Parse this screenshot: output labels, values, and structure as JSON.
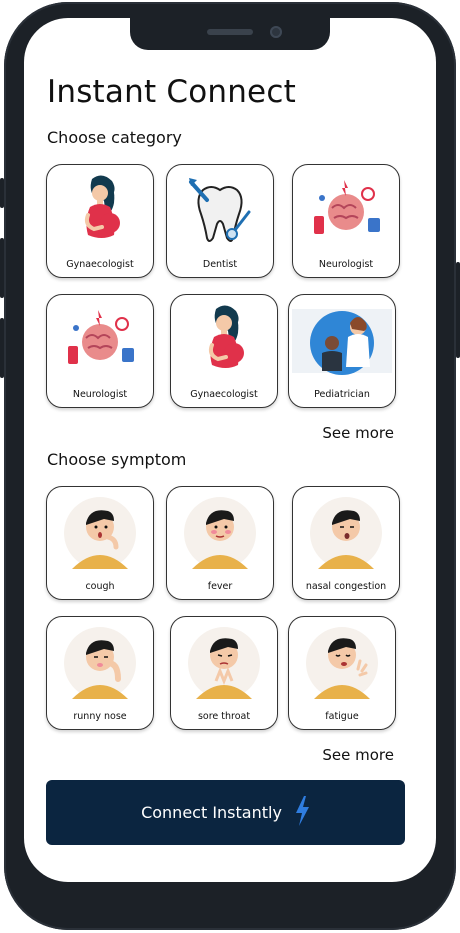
{
  "page": {
    "title": "Instant Connect",
    "category_heading": "Choose category",
    "symptom_heading": "Choose symptom",
    "see_more_categories": "See more",
    "see_more_symptoms": "See more",
    "cta_label": "Connect Instantly"
  },
  "categories": [
    {
      "label": "Gynaecologist",
      "icon": "pregnant-woman-icon"
    },
    {
      "label": "Dentist",
      "icon": "tooth-icon"
    },
    {
      "label": "Neurologist",
      "icon": "brain-icon"
    },
    {
      "label": "Neurologist",
      "icon": "brain-icon"
    },
    {
      "label": "Gynaecologist",
      "icon": "pregnant-woman-icon"
    },
    {
      "label": "Pediatrician",
      "icon": "doctor-child-icon"
    }
  ],
  "symptoms": [
    {
      "label": "cough",
      "icon": "cough-person-icon"
    },
    {
      "label": "fever",
      "icon": "fever-person-icon"
    },
    {
      "label": "nasal congestion",
      "icon": "nasal-person-icon"
    },
    {
      "label": "runny nose",
      "icon": "runny-nose-person-icon"
    },
    {
      "label": "sore throat",
      "icon": "sore-throat-person-icon"
    },
    {
      "label": "fatigue",
      "icon": "fatigue-person-icon"
    }
  ],
  "colors": {
    "cta_bg": "#0b2540",
    "bolt": "#2f7de0",
    "phone_frame": "#1c2127",
    "skin": "#f4c9a8",
    "shirt": "#e8b14a",
    "dress": "#e0314a"
  }
}
